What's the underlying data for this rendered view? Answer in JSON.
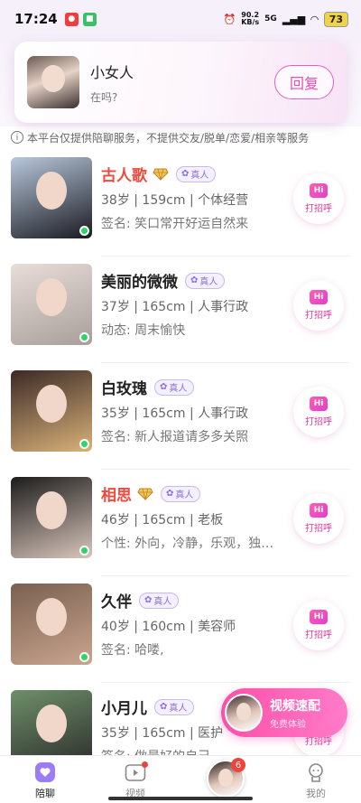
{
  "status_bar": {
    "time": "17:24",
    "net_speed_value": "90.2",
    "net_speed_unit": "KB/s",
    "network": "5G",
    "battery": "73"
  },
  "message_popup": {
    "name": "小女人",
    "preview": "在吗?",
    "reply_label": "回复"
  },
  "notice": "本平台仅提供陪聊服务，不提供交友/脱单/恋爱/相亲等服务",
  "users": [
    {
      "name": "古人歌",
      "vip": true,
      "verified_label": "真人",
      "info": "38岁 | 159cm | 个体经营",
      "sign": "签名: 笑口常开好运自然来",
      "greet_label": "打招呼",
      "hi": "Hi",
      "photo_colors": [
        "#b8c8dc",
        "#1b1b22"
      ]
    },
    {
      "name": "美丽的微微",
      "vip": false,
      "verified_label": "真人",
      "info": "37岁 | 165cm | 人事行政",
      "sign": "动态: 周末愉快",
      "greet_label": "打招呼",
      "hi": "Hi",
      "photo_colors": [
        "#e8ddd8",
        "#a89f9b"
      ]
    },
    {
      "name": "白玫瑰",
      "vip": false,
      "verified_label": "真人",
      "info": "35岁 | 165cm | 人事行政",
      "sign": "签名: 新人报道请多多关照",
      "greet_label": "打招呼",
      "hi": "Hi",
      "photo_colors": [
        "#3b2a25",
        "#d9b27a"
      ]
    },
    {
      "name": "相思",
      "vip": true,
      "verified_label": "真人",
      "info": "46岁 | 165cm | 老板",
      "sign": "个性: 外向，冷静，乐观，独…",
      "greet_label": "打招呼",
      "hi": "Hi",
      "photo_colors": [
        "#1c1c1c",
        "#d8c6bb"
      ]
    },
    {
      "name": "久伴",
      "vip": false,
      "verified_label": "真人",
      "info": "40岁 | 160cm | 美容师",
      "sign": "签名: 哈喽,",
      "greet_label": "打招呼",
      "hi": "Hi",
      "photo_colors": [
        "#7a6050",
        "#c9a58f"
      ]
    },
    {
      "name": "小月儿",
      "vip": false,
      "verified_label": "真人",
      "info": "35岁 | 165cm | 医护",
      "sign": "签名: 做最好的自己",
      "greet_label": "打招呼",
      "hi": "Hi",
      "photo_colors": [
        "#6f8f6a",
        "#2a2a2a"
      ]
    }
  ],
  "video_match": {
    "title": "视频速配",
    "subtitle": "免费体验"
  },
  "nav": {
    "chat_label": "陪聊",
    "video_label": "视频",
    "badge_count": "6",
    "mine_label": "我的"
  },
  "colors": {
    "accent_pink": "#e052b8",
    "vip_red": "#f04a3e",
    "online_green": "#2fd36b",
    "verified_purple": "#8a6fe0"
  }
}
